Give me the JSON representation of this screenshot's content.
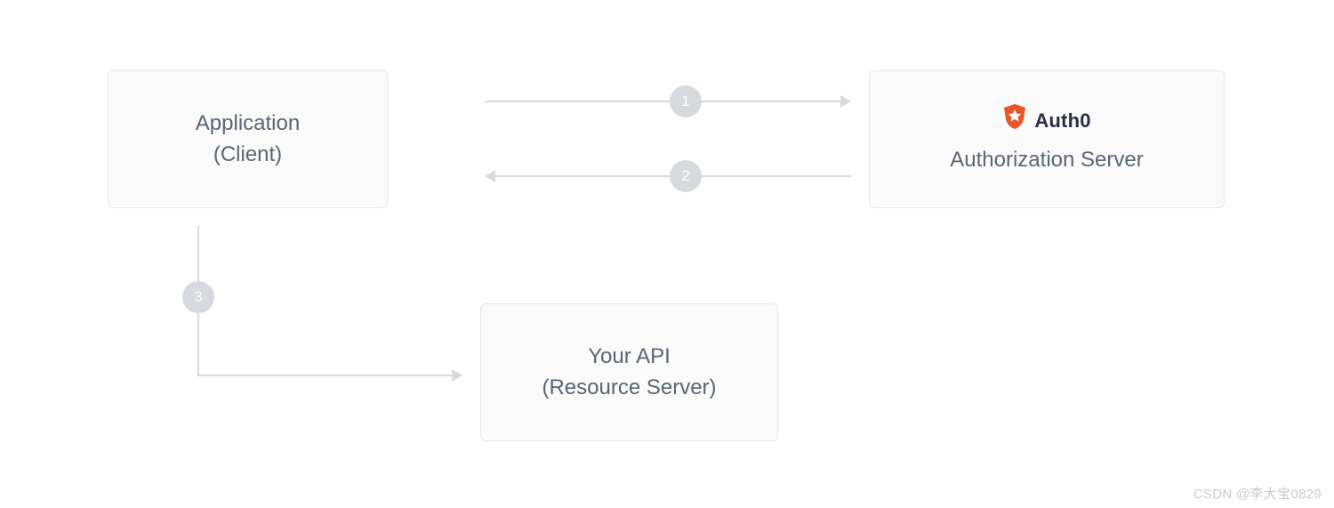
{
  "nodes": {
    "client": {
      "line1": "Application",
      "line2": "(Client)"
    },
    "auth_server": {
      "brand": "Auth0",
      "line2": "Authorization Server"
    },
    "api": {
      "line1": "Your API",
      "line2": "(Resource Server)"
    }
  },
  "steps": {
    "one": "1",
    "two": "2",
    "three": "3"
  },
  "watermark": "CSDN @李大宝0829",
  "colors": {
    "node_bg": "#fafafb",
    "node_border": "#e5e7ea",
    "text": "#5a6574",
    "arrow": "#d6d9dd",
    "brand_shield": "#eb5424",
    "brand_text": "#2a2e45"
  }
}
